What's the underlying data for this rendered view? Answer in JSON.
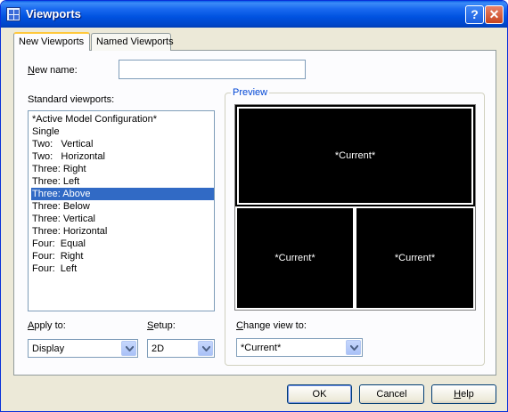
{
  "window": {
    "title": "Viewports"
  },
  "tabs": [
    {
      "label": "New Viewports",
      "active": true
    },
    {
      "label": "Named Viewports",
      "active": false
    }
  ],
  "new_name": {
    "label": "New name:",
    "mnemonic": "N",
    "rest": "ew name:",
    "value": ""
  },
  "standard_viewports": {
    "label": "Standard viewports:",
    "items": [
      "*Active Model Configuration*",
      "Single",
      "Two:   Vertical",
      "Two:   Horizontal",
      "Three: Right",
      "Three: Left",
      "Three: Above",
      "Three: Below",
      "Three: Vertical",
      "Three: Horizontal",
      "Four:  Equal",
      "Four:  Right",
      "Four:  Left"
    ],
    "selected_index": 6
  },
  "preview": {
    "label": "Preview",
    "viewports": [
      "*Current*",
      "*Current*",
      "*Current*"
    ]
  },
  "apply_to": {
    "mnemonic": "A",
    "rest": "pply to:",
    "value": "Display"
  },
  "setup": {
    "mnemonic": "S",
    "rest": "etup:",
    "value": "2D"
  },
  "change_view": {
    "mnemonic": "C",
    "rest": "hange view to:",
    "value": "*Current*"
  },
  "buttons": {
    "ok": "OK",
    "cancel": "Cancel",
    "help": "Help"
  },
  "colors": {
    "selection": "#316ac5",
    "titlebar": "#0052e0",
    "preview_bg": "#000000"
  }
}
